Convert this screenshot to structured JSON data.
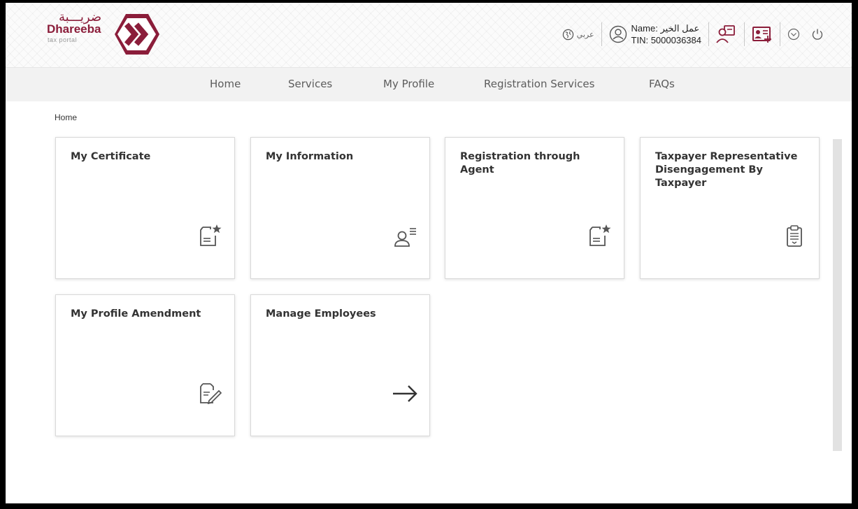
{
  "header": {
    "logo": {
      "arabic": "ضريـــبة",
      "name": "Dhareeba",
      "subtitle": "tax portal"
    },
    "language_label": "عربي",
    "user": {
      "name_line": "Name: عمل الخير",
      "tin_line": "TIN: 5000036384"
    },
    "icons": [
      "globe-icon",
      "user-circle-icon",
      "user-switch-icon",
      "id-card-add-icon",
      "chevron-down-icon",
      "power-icon"
    ]
  },
  "nav": {
    "items": [
      {
        "label": "Home"
      },
      {
        "label": "Services"
      },
      {
        "label": "My Profile"
      },
      {
        "label": "Registration Services"
      },
      {
        "label": "FAQs"
      }
    ]
  },
  "breadcrumb": "Home",
  "cards": [
    {
      "title": "My Certificate",
      "icon": "certificate-icon"
    },
    {
      "title": "My Information",
      "icon": "user-info-icon"
    },
    {
      "title": "Registration through Agent",
      "icon": "certificate-icon"
    },
    {
      "title": "Taxpayer Representative Disengagement By Taxpayer",
      "icon": "clipboard-icon"
    },
    {
      "title": "My Profile Amendment",
      "icon": "document-edit-icon"
    },
    {
      "title": "Manage Employees",
      "icon": "arrow-right-icon"
    }
  ],
  "colors": {
    "brand": "#8b1d3a",
    "nav_bg": "#f2f2f2",
    "icon": "#555555"
  }
}
